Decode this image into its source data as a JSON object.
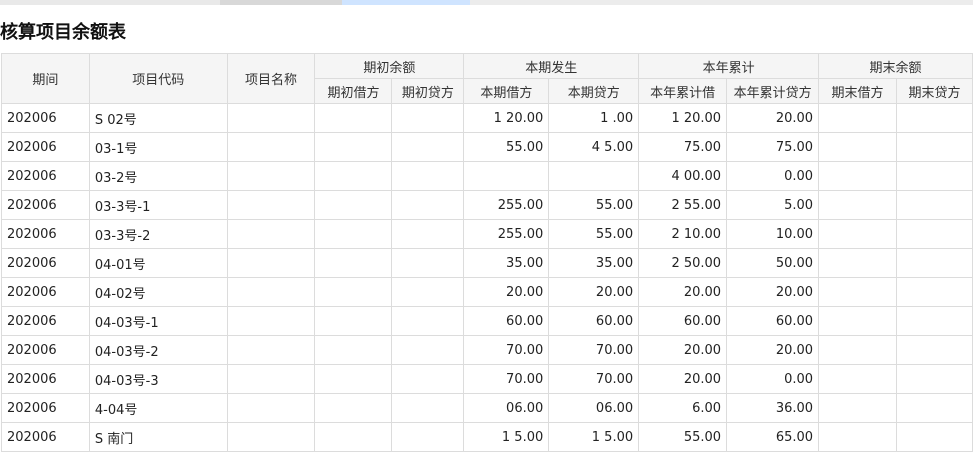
{
  "title": "核算项目余额表",
  "headers": {
    "period": "期间",
    "item_code": "项目代码",
    "item_name": "项目名称",
    "opening_group": "期初余额",
    "opening_debit": "期初借方",
    "opening_credit": "期初贷方",
    "current_group": "本期发生",
    "current_debit": "本期借方",
    "current_credit": "本期贷方",
    "ytd_group": "本年累计",
    "ytd_debit": "本年累计借",
    "ytd_credit": "本年累计贷方",
    "closing_group": "期末余额",
    "closing_debit": "期末借方",
    "closing_credit": "期末贷方"
  },
  "rows": [
    {
      "period": "202006",
      "code": "S 02号",
      "name": "",
      "od": "",
      "oc": "",
      "cd": "1 20.00",
      "cc": "1 .00",
      "yd": "1 20.00",
      "yc": "20.00",
      "ed": "",
      "ec": ""
    },
    {
      "period": "202006",
      "code": "03-1号",
      "name": "",
      "od": "",
      "oc": "",
      "cd": "55.00",
      "cc": "4 5.00",
      "yd": "75.00",
      "yc": "75.00",
      "ed": "",
      "ec": ""
    },
    {
      "period": "202006",
      "code": "03-2号",
      "name": "",
      "od": "",
      "oc": "",
      "cd": "",
      "cc": "",
      "yd": "4 00.00",
      "yc": "0.00",
      "ed": "",
      "ec": ""
    },
    {
      "period": "202006",
      "code": "03-3号-1",
      "name": "",
      "od": "",
      "oc": "",
      "cd": "255.00",
      "cc": "55.00",
      "yd": "2 55.00",
      "yc": "5.00",
      "ed": "",
      "ec": ""
    },
    {
      "period": "202006",
      "code": "03-3号-2",
      "name": "",
      "od": "",
      "oc": "",
      "cd": "255.00",
      "cc": "55.00",
      "yd": "2 10.00",
      "yc": "10.00",
      "ed": "",
      "ec": ""
    },
    {
      "period": "202006",
      "code": "04-01号",
      "name": "",
      "od": "",
      "oc": "",
      "cd": "35.00",
      "cc": "35.00",
      "yd": "2 50.00",
      "yc": "50.00",
      "ed": "",
      "ec": ""
    },
    {
      "period": "202006",
      "code": "04-02号",
      "name": "",
      "od": "",
      "oc": "",
      "cd": "20.00",
      "cc": "20.00",
      "yd": "20.00",
      "yc": "20.00",
      "ed": "",
      "ec": ""
    },
    {
      "period": "202006",
      "code": "04-03号-1",
      "name": "",
      "od": "",
      "oc": "",
      "cd": "60.00",
      "cc": "60.00",
      "yd": "60.00",
      "yc": "60.00",
      "ed": "",
      "ec": ""
    },
    {
      "period": "202006",
      "code": "04-03号-2",
      "name": "",
      "od": "",
      "oc": "",
      "cd": "70.00",
      "cc": "70.00",
      "yd": "20.00",
      "yc": "20.00",
      "ed": "",
      "ec": ""
    },
    {
      "period": "202006",
      "code": "04-03号-3",
      "name": "",
      "od": "",
      "oc": "",
      "cd": "70.00",
      "cc": "70.00",
      "yd": "20.00",
      "yc": "0.00",
      "ed": "",
      "ec": ""
    },
    {
      "period": "202006",
      "code": "4-04号",
      "name": "",
      "od": "",
      "oc": "",
      "cd": "06.00",
      "cc": "06.00",
      "yd": "6.00",
      "yc": "36.00",
      "ed": "",
      "ec": ""
    },
    {
      "period": "202006",
      "code": "S 南门",
      "name": "",
      "od": "",
      "oc": "",
      "cd": "1 5.00",
      "cc": "1 5.00",
      "yd": "55.00",
      "yc": "65.00",
      "ed": "",
      "ec": ""
    }
  ]
}
